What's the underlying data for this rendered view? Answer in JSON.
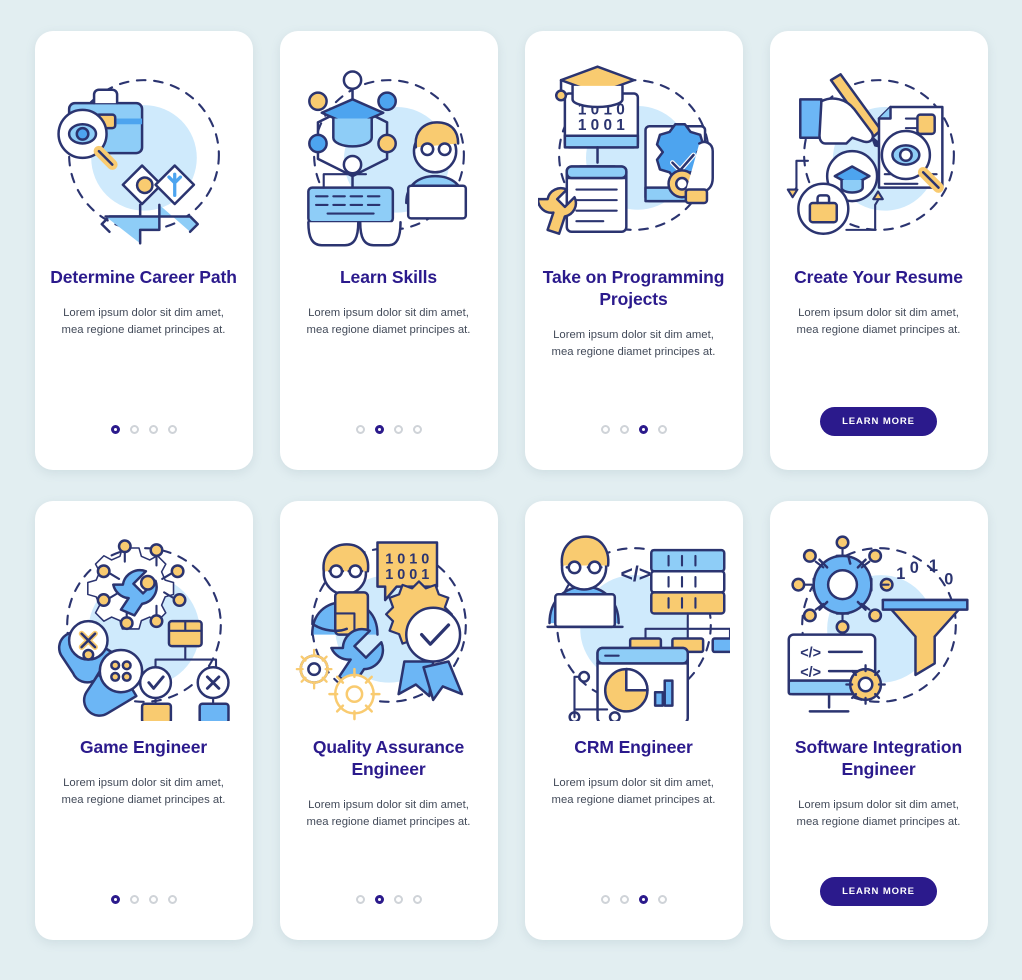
{
  "page": {
    "background_color": "#e2eef1",
    "card_background": "#ffffff",
    "title_color": "#2b1a8c",
    "body_color": "#424a59",
    "accent_blue": "#4da4ef",
    "accent_light_blue": "#8ecdf7",
    "accent_yellow": "#f9cb70",
    "outline_color": "#2b3470",
    "button_color": "#2b1a8c",
    "dot_inactive_color": "#cfd3d8"
  },
  "common": {
    "description": "Lorem ipsum dolor sit dim amet, mea regione diamet principes at.",
    "learn_more_label": "LEARN MORE"
  },
  "screens": [
    {
      "id": "determine-career-path",
      "title": "Determine Career Path",
      "illustration": "career-search-icon",
      "description": "Lorem ipsum dolor sit dim amet, mea regione diamet principes at.",
      "footer_type": "dots",
      "dots": {
        "count": 4,
        "active_index": 0
      }
    },
    {
      "id": "learn-skills",
      "title": "Learn Skills",
      "illustration": "learning-network-icon",
      "description": "Lorem ipsum dolor sit dim amet, mea regione diamet principes at.",
      "footer_type": "dots",
      "dots": {
        "count": 4,
        "active_index": 1
      }
    },
    {
      "id": "take-on-programming-projects",
      "title": "Take on Programming Projects",
      "illustration": "programming-projects-icon",
      "description": "Lorem ipsum dolor sit dim amet, mea regione diamet principes at.",
      "footer_type": "dots",
      "dots": {
        "count": 4,
        "active_index": 2
      },
      "binary_text": [
        "1 0 1 0",
        "1 0 0 1"
      ]
    },
    {
      "id": "create-your-resume",
      "title": "Create Your Resume",
      "illustration": "resume-writing-icon",
      "description": "Lorem ipsum dolor sit dim amet, mea regione diamet principes at.",
      "footer_type": "button",
      "button_label": "LEARN MORE"
    },
    {
      "id": "game-engineer",
      "title": "Game Engineer",
      "illustration": "game-engineer-icon",
      "description": "Lorem ipsum dolor sit dim amet, mea regione diamet principes at.",
      "footer_type": "dots",
      "dots": {
        "count": 4,
        "active_index": 0
      }
    },
    {
      "id": "quality-assurance-engineer",
      "title": "Quality Assurance Engineer",
      "illustration": "quality-assurance-icon",
      "description": "Lorem ipsum dolor sit dim amet, mea regione diamet principes at.",
      "footer_type": "dots",
      "dots": {
        "count": 4,
        "active_index": 1
      },
      "binary_text": [
        "1 0 1 0",
        "1 0 0 1"
      ]
    },
    {
      "id": "crm-engineer",
      "title": "CRM Engineer",
      "illustration": "crm-engineer-icon",
      "description": "Lorem ipsum dolor sit dim amet, mea regione diamet principes at.",
      "footer_type": "dots",
      "dots": {
        "count": 4,
        "active_index": 2
      },
      "code_glyph": "</>"
    },
    {
      "id": "software-integration-engineer",
      "title": "Software Integration Engineer",
      "illustration": "software-integration-icon",
      "description": "Lorem ipsum dolor sit dim amet, mea regione diamet principes at.",
      "footer_type": "button",
      "button_label": "LEARN MORE",
      "code_glyph": "</>",
      "binary_text": [
        "1",
        "0",
        "1",
        "0"
      ]
    }
  ]
}
